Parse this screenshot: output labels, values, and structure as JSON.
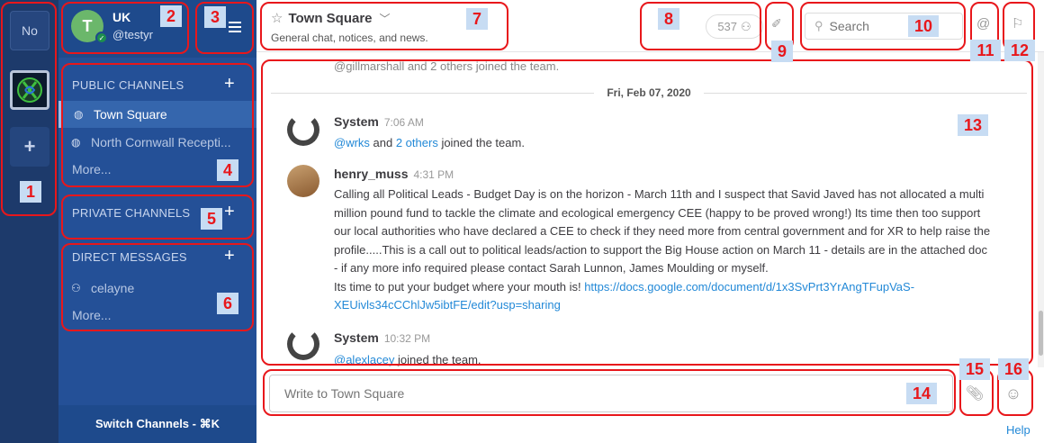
{
  "team_sidebar": {
    "team_initials": "No",
    "add_label": "+"
  },
  "sidebar": {
    "team_name": "UK",
    "avatar_initial": "T",
    "username": "@testyr",
    "public_header": "PUBLIC CHANNELS",
    "public_channels": [
      {
        "label": "Town Square"
      },
      {
        "label": "North Cornwall Recepti..."
      }
    ],
    "public_more": "More...",
    "private_header": "PRIVATE CHANNELS",
    "dm_header": "DIRECT MESSAGES",
    "dm_items": [
      {
        "label": "celayne"
      }
    ],
    "dm_more": "More...",
    "add_label": "+",
    "switch_channels": "Switch Channels - ⌘K"
  },
  "header": {
    "channel_name": "Town Square",
    "purpose": "General chat, notices, and news.",
    "member_count": "537",
    "search_placeholder": "Search"
  },
  "messages": {
    "top_join_text": "@gillmarshall and 2 others joined the team.",
    "date_separator": "Fri, Feb 07, 2020",
    "m1_author": "System",
    "m1_time": "7:06 AM",
    "m1_mention": "@wrks",
    "m1_mid": " and ",
    "m1_others": "2 others",
    "m1_tail": " joined the team.",
    "m2_author": "henry_muss",
    "m2_time": "4:31 PM",
    "m2_text": "Calling all Political Leads - Budget Day is on the horizon - March 11th and I suspect that Savid Javed has not allocated a multi million pound fund to tackle the climate and ecological emergency CEE (happy to be proved wrong!) Its time then too support our local authorities who have declared a CEE to check if they need more from central government and for XR to help raise the profile.....This is a call out to political leads/action to support the Big House action on March 11 - details are in the attached doc - if any more info required please contact Sarah Lunnon, James Moulding or myself.",
    "m2_text2": "Its time to put your budget where your mouth is! ",
    "m2_link": "https://docs.google.com/document/d/1x3SvPrt3YrAngTFupVaS-XEUivls34cCChlJw5ibtFE/edit?usp=sharing",
    "m3_author": "System",
    "m3_time": "10:32 PM",
    "m3_mention": "@alexlacey",
    "m3_tail": " joined the team."
  },
  "composer": {
    "placeholder": "Write to Town Square",
    "help": "Help"
  },
  "annotations": [
    "1",
    "2",
    "3",
    "4",
    "5",
    "6",
    "7",
    "8",
    "9",
    "10",
    "11",
    "12",
    "13",
    "14",
    "15",
    "16"
  ],
  "colors": {
    "annotation": "#e8171b",
    "label_bg": "#c7dcf3",
    "sidebar": "#245097",
    "team_bar": "#1d3a6b",
    "link": "#2389d7"
  }
}
